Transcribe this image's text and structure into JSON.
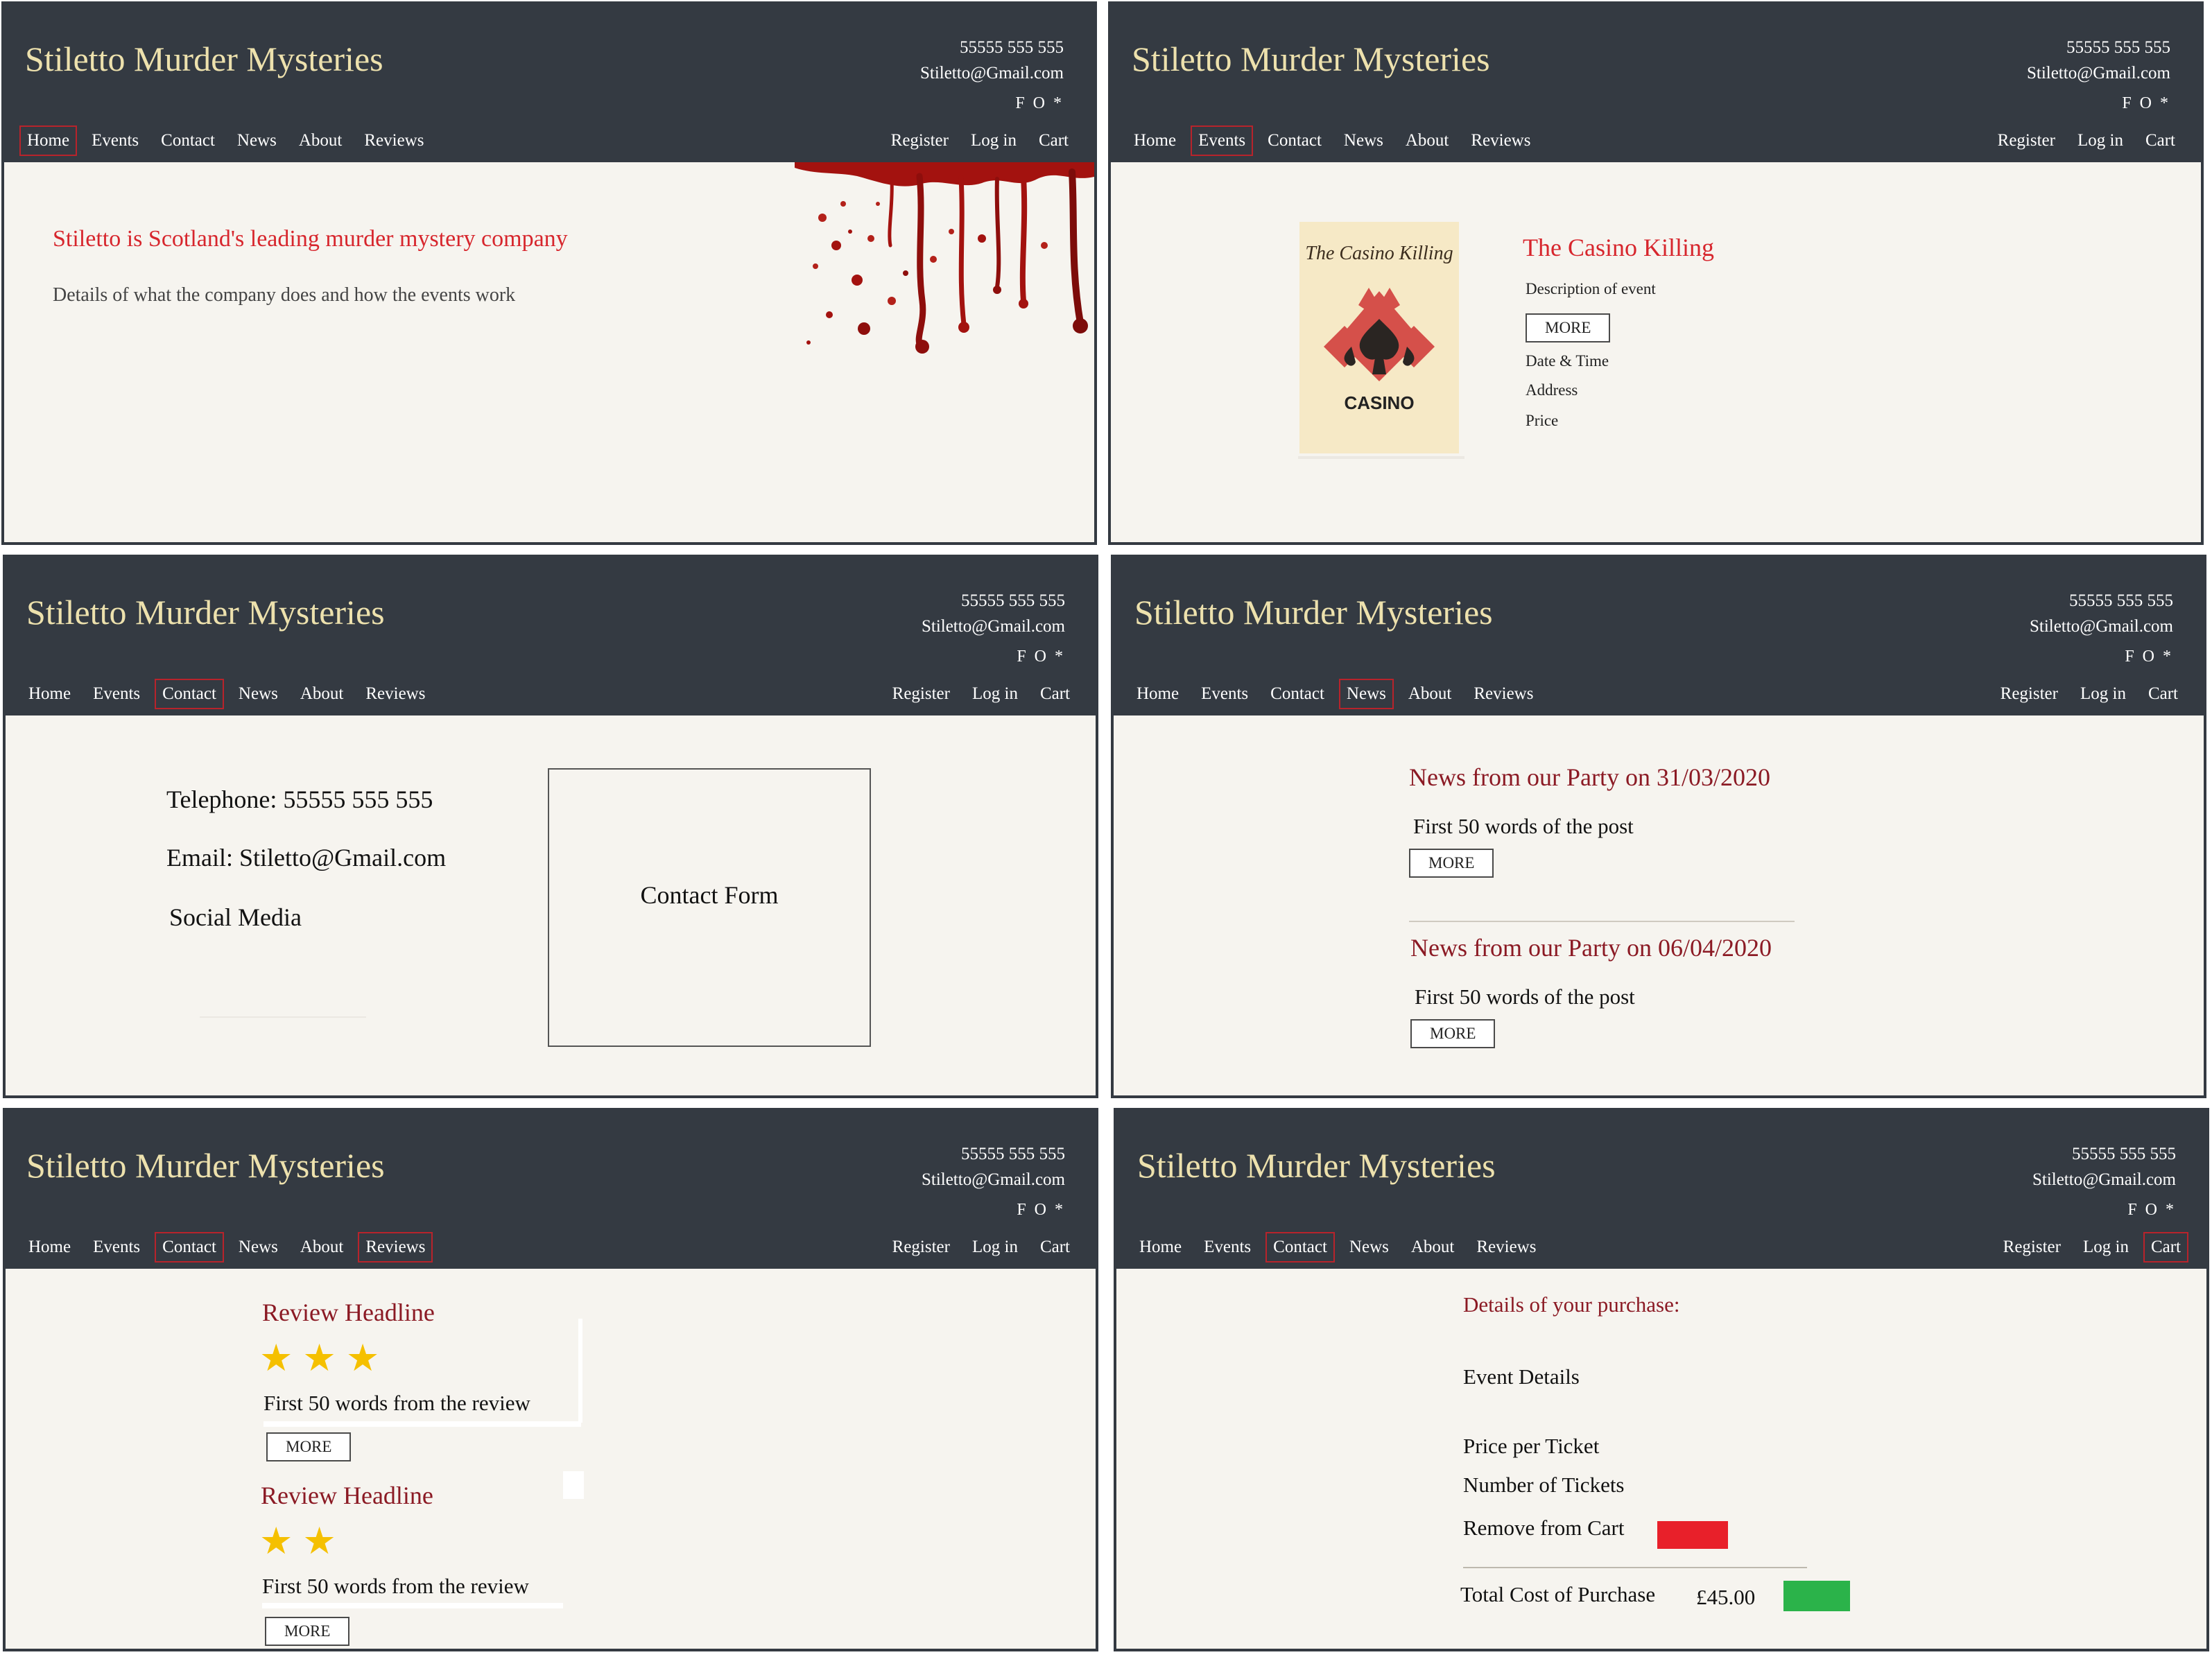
{
  "site": {
    "brand": "Stiletto Murder Mysteries",
    "phone": "55555 555 555",
    "email": "Stiletto@Gmail.com",
    "social": "F O *",
    "nav": [
      "Home",
      "Events",
      "Contact",
      "News",
      "About",
      "Reviews"
    ],
    "account": [
      "Register",
      "Log in",
      "Cart"
    ]
  },
  "colors": {
    "header": "#343a42",
    "brand": "#ede1ad",
    "page_bg": "#f6f4ef",
    "accent_red": "#d7262d",
    "maroon": "#8b1a24",
    "active_outline": "#b8232b",
    "star": "#f5c000",
    "remove": "#e8202a",
    "checkout": "#2bb34a"
  },
  "panels": [
    {
      "id": "home",
      "active_nav": [
        "Home"
      ],
      "title": "Stiletto is Scotland's leading murder mystery company",
      "text": "Details of what the company does and how the events work"
    },
    {
      "id": "events",
      "active_nav": [
        "Events"
      ],
      "poster_title": "The Casino Killing",
      "poster_word": "CASINO",
      "title": "The Casino Killing",
      "description": "Description of event",
      "more": "MORE",
      "date_time": "Date & Time",
      "address": "Address",
      "price": "Price"
    },
    {
      "id": "contact",
      "active_nav": [
        "Contact"
      ],
      "telephone": "Telephone: 55555 555 555",
      "email": "Email: Stiletto@Gmail.com",
      "social_media": "Social Media",
      "form": "Contact Form"
    },
    {
      "id": "news",
      "active_nav": [
        "News"
      ],
      "posts": [
        {
          "title": "News from our Party on 31/03/2020",
          "excerpt": "First 50 words of the post",
          "more": "MORE"
        },
        {
          "title": "News from our Party on 06/04/2020",
          "excerpt": "First 50 words of the post",
          "more": "MORE"
        }
      ]
    },
    {
      "id": "reviews",
      "active_nav": [
        "Contact",
        "Reviews"
      ],
      "reviews": [
        {
          "headline": "Review Headline",
          "stars": 3,
          "excerpt": "First 50 words from the review",
          "more": "MORE"
        },
        {
          "headline": "Review Headline",
          "stars": 2,
          "excerpt": "First 50 words from the review",
          "more": "MORE"
        }
      ]
    },
    {
      "id": "cart",
      "active_nav": [
        "Contact",
        "Cart"
      ],
      "title": "Details of your purchase:",
      "event_details": "Event Details",
      "price_per_ticket": "Price per Ticket",
      "number_of_tickets": "Number of Tickets",
      "remove": "Remove from Cart",
      "total_label": "Total Cost of Purchase",
      "total_value": "£45.00"
    }
  ]
}
